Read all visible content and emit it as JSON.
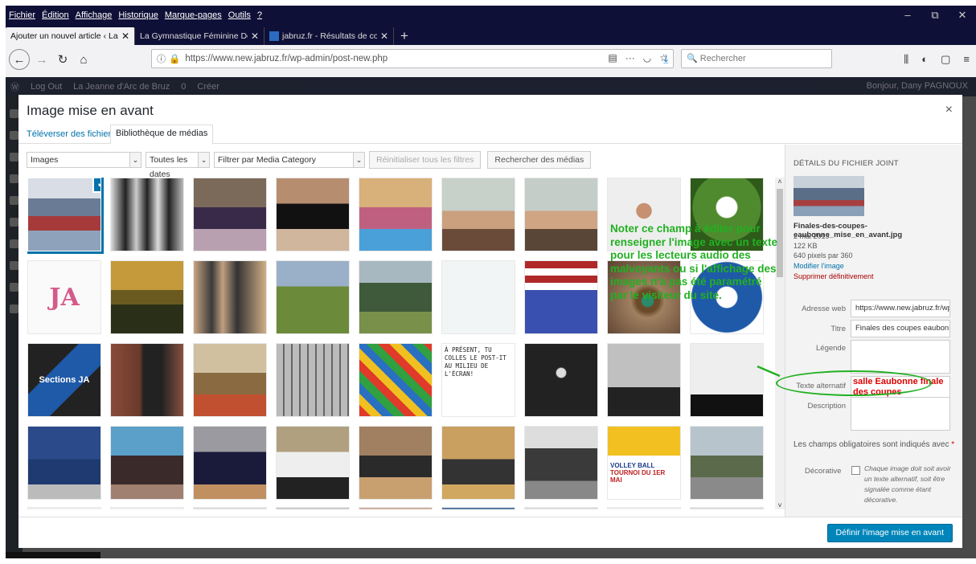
{
  "menubar": {
    "items": [
      "Fichier",
      "Édition",
      "Affichage",
      "Historique",
      "Marque-pages",
      "Outils",
      "?"
    ]
  },
  "window_controls": {
    "minimize": "–",
    "restore": "⧉",
    "close": "✕"
  },
  "tabs": [
    {
      "label": "Ajouter un nouvel article ‹ La Jeann",
      "close": "✕",
      "active": true
    },
    {
      "label": "La Gymnastique Féminine Domrém",
      "close": "✕",
      "active": false
    },
    {
      "label": "jabruz.fr - Résultats de compét",
      "close": "✕",
      "active": false
    }
  ],
  "new_tab": "+",
  "nav": {
    "url": "https://www.new.jabruz.fr/wp-admin/post-new.php",
    "search_placeholder": "Rechercher"
  },
  "adminbar": {
    "logout": "Log Out",
    "site": "La Jeanne d'Arc de Bruz",
    "comments": "0",
    "new": "Créer",
    "greeting": "Bonjour, Dany PAGNOUX"
  },
  "modal": {
    "title": "Image mise en avant",
    "close": "×",
    "tabs": [
      "Téléverser des fichiers",
      "Bibliothèque de médias"
    ],
    "filters": {
      "type": "Images",
      "dates": "Toutes les dates",
      "category": "Filtrer par Media Category",
      "reset": "Réinitialiser tous les filtres",
      "search": "Rechercher des médias"
    },
    "submit": "Définir l'image mise en avant"
  },
  "details": {
    "heading": "DÉTAILS DU FICHIER JOINT",
    "filename": "Finales-des-coupes-eaubonne_mise_en_avant.jpg",
    "date": "2 mai 2019",
    "size": "122 KB",
    "dimensions": "640 pixels par 360",
    "edit": "Modifier l'image",
    "delete": "Supprimer définitivement",
    "labels": {
      "url": "Adresse web",
      "title": "Titre",
      "caption": "Légende",
      "alt": "Texte alternatif",
      "description": "Description"
    },
    "values": {
      "url": "https://www.new.jabruz.fr/wp",
      "title": "Finales des coupes eaubonne,",
      "alt": "salle Eaubonne finale des coupes"
    },
    "required": "Les champs obligatoires sont indiqués avec",
    "required_star": "*",
    "decorative_label": "Décorative",
    "decorative_text": "Chaque image doit soit avoir un texte alternatif, soit être signalée comme étant décorative."
  },
  "annotation": "Noter ce champ à éditer pour renseigner l'image avec un texte pour les lecteurs audio des malvoyants ou si l'affichage des images n'a pas été paramétré par le visiteur du site.",
  "thumb_texts": {
    "sections": "Sections JA",
    "postit": "À PRÉSENT, TU COLLES LE POST-IT AU MILIEU DE L'ÉCRAN!",
    "volley": "VOLLEY BALL",
    "tournoi": "TOURNOI DU 1ER MAI"
  }
}
